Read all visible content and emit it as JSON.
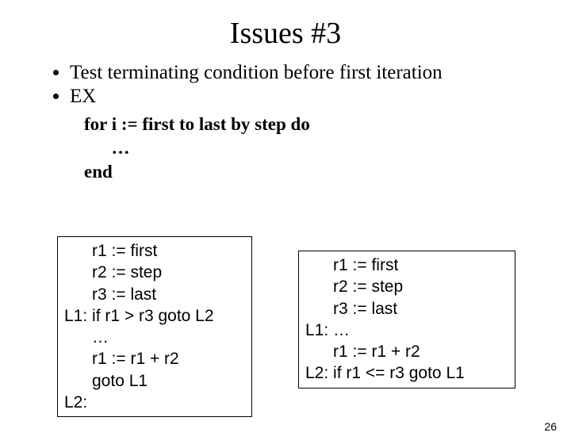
{
  "title": "Issues #3",
  "bullets": {
    "b1": "Test terminating condition before first iteration",
    "b2": "EX"
  },
  "pseudo": {
    "l1": "for i := first to last by step do",
    "l2": "      …",
    "l3": "end"
  },
  "leftbox": "      r1 := first\n      r2 := step\n      r3 := last\nL1: if r1 > r3 goto L2\n      …\n      r1 := r1 + r2\n      goto L1\nL2:",
  "rightbox": "      r1 := first\n      r2 := step\n      r3 := last\nL1: …\n      r1 := r1 + r2\nL2: if r1 <= r3 goto L1",
  "pagenum": "26"
}
